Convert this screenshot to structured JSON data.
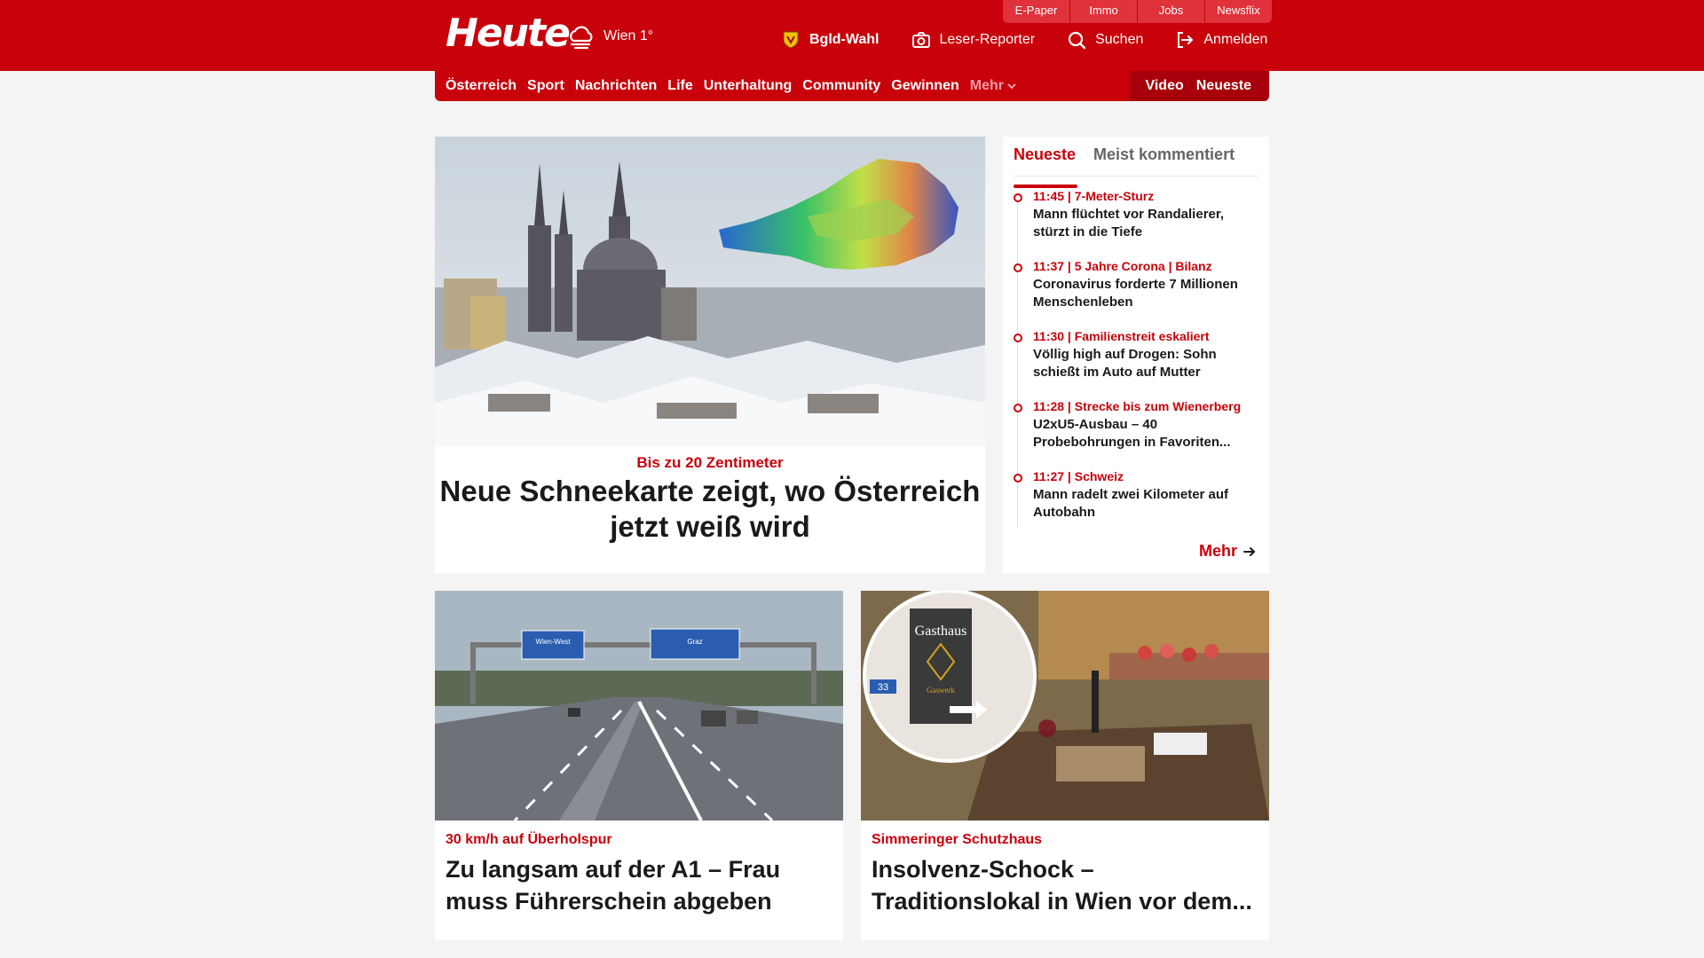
{
  "header": {
    "logo": "Heute",
    "weather": "Wien 1°",
    "util_links": [
      "E-Paper",
      "Immo",
      "Jobs",
      "Newsflix"
    ],
    "actions": {
      "election": "Bgld-Wahl",
      "reporter": "Leser-Reporter",
      "search": "Suchen",
      "login": "Anmelden"
    }
  },
  "nav": {
    "items": [
      "Österreich",
      "Sport",
      "Nachrichten",
      "Life",
      "Unterhaltung",
      "Community",
      "Gewinnen"
    ],
    "more": "Mehr",
    "video": "Video",
    "latest": "Neueste"
  },
  "hero": {
    "kicker": "Bis zu 20 Zentimeter",
    "title": "Neue Schneekarte zeigt, wo Österreich jetzt weiß wird"
  },
  "sidebar": {
    "tabs": [
      "Neueste",
      "Meist kommentiert"
    ],
    "items": [
      {
        "time": "11:45",
        "tag": "7-Meter-Sturz",
        "headline": "Mann flüchtet vor Randalierer, stürzt in die Tiefe"
      },
      {
        "time": "11:37",
        "tag": "5 Jahre Corona | Bilanz",
        "headline": "Coronavirus forderte 7 Millionen Menschenleben"
      },
      {
        "time": "11:30",
        "tag": "Familienstreit eskaliert",
        "headline": "Völlig high auf Drogen: Sohn schießt im Auto auf Mutter"
      },
      {
        "time": "11:28",
        "tag": "Strecke bis zum Wienerberg",
        "headline": "U2xU5-Ausbau – 40 Probebohrungen in Favoriten..."
      },
      {
        "time": "11:27",
        "tag": "Schweiz",
        "headline": "Mann radelt zwei Kilometer auf Autobahn"
      }
    ],
    "more": "Mehr"
  },
  "cards": [
    {
      "kicker": "30 km/h auf Überholspur",
      "title": "Zu langsam auf der A1 – Frau muss Führerschein abgeben"
    },
    {
      "kicker": "Simmeringer Schutzhaus",
      "title": "Insolvenz-Schock – Traditionslokal in Wien vor dem..."
    }
  ],
  "image_text": {
    "sign_left": "Wien-West",
    "sign_right": "Graz",
    "gasthaus": "Gasthaus",
    "gaswerk": "Gaswerk",
    "route_number": "33"
  },
  "colors": {
    "brand": "#c8010a",
    "brand_dark": "#a8000a",
    "background": "#f4f4f4"
  }
}
